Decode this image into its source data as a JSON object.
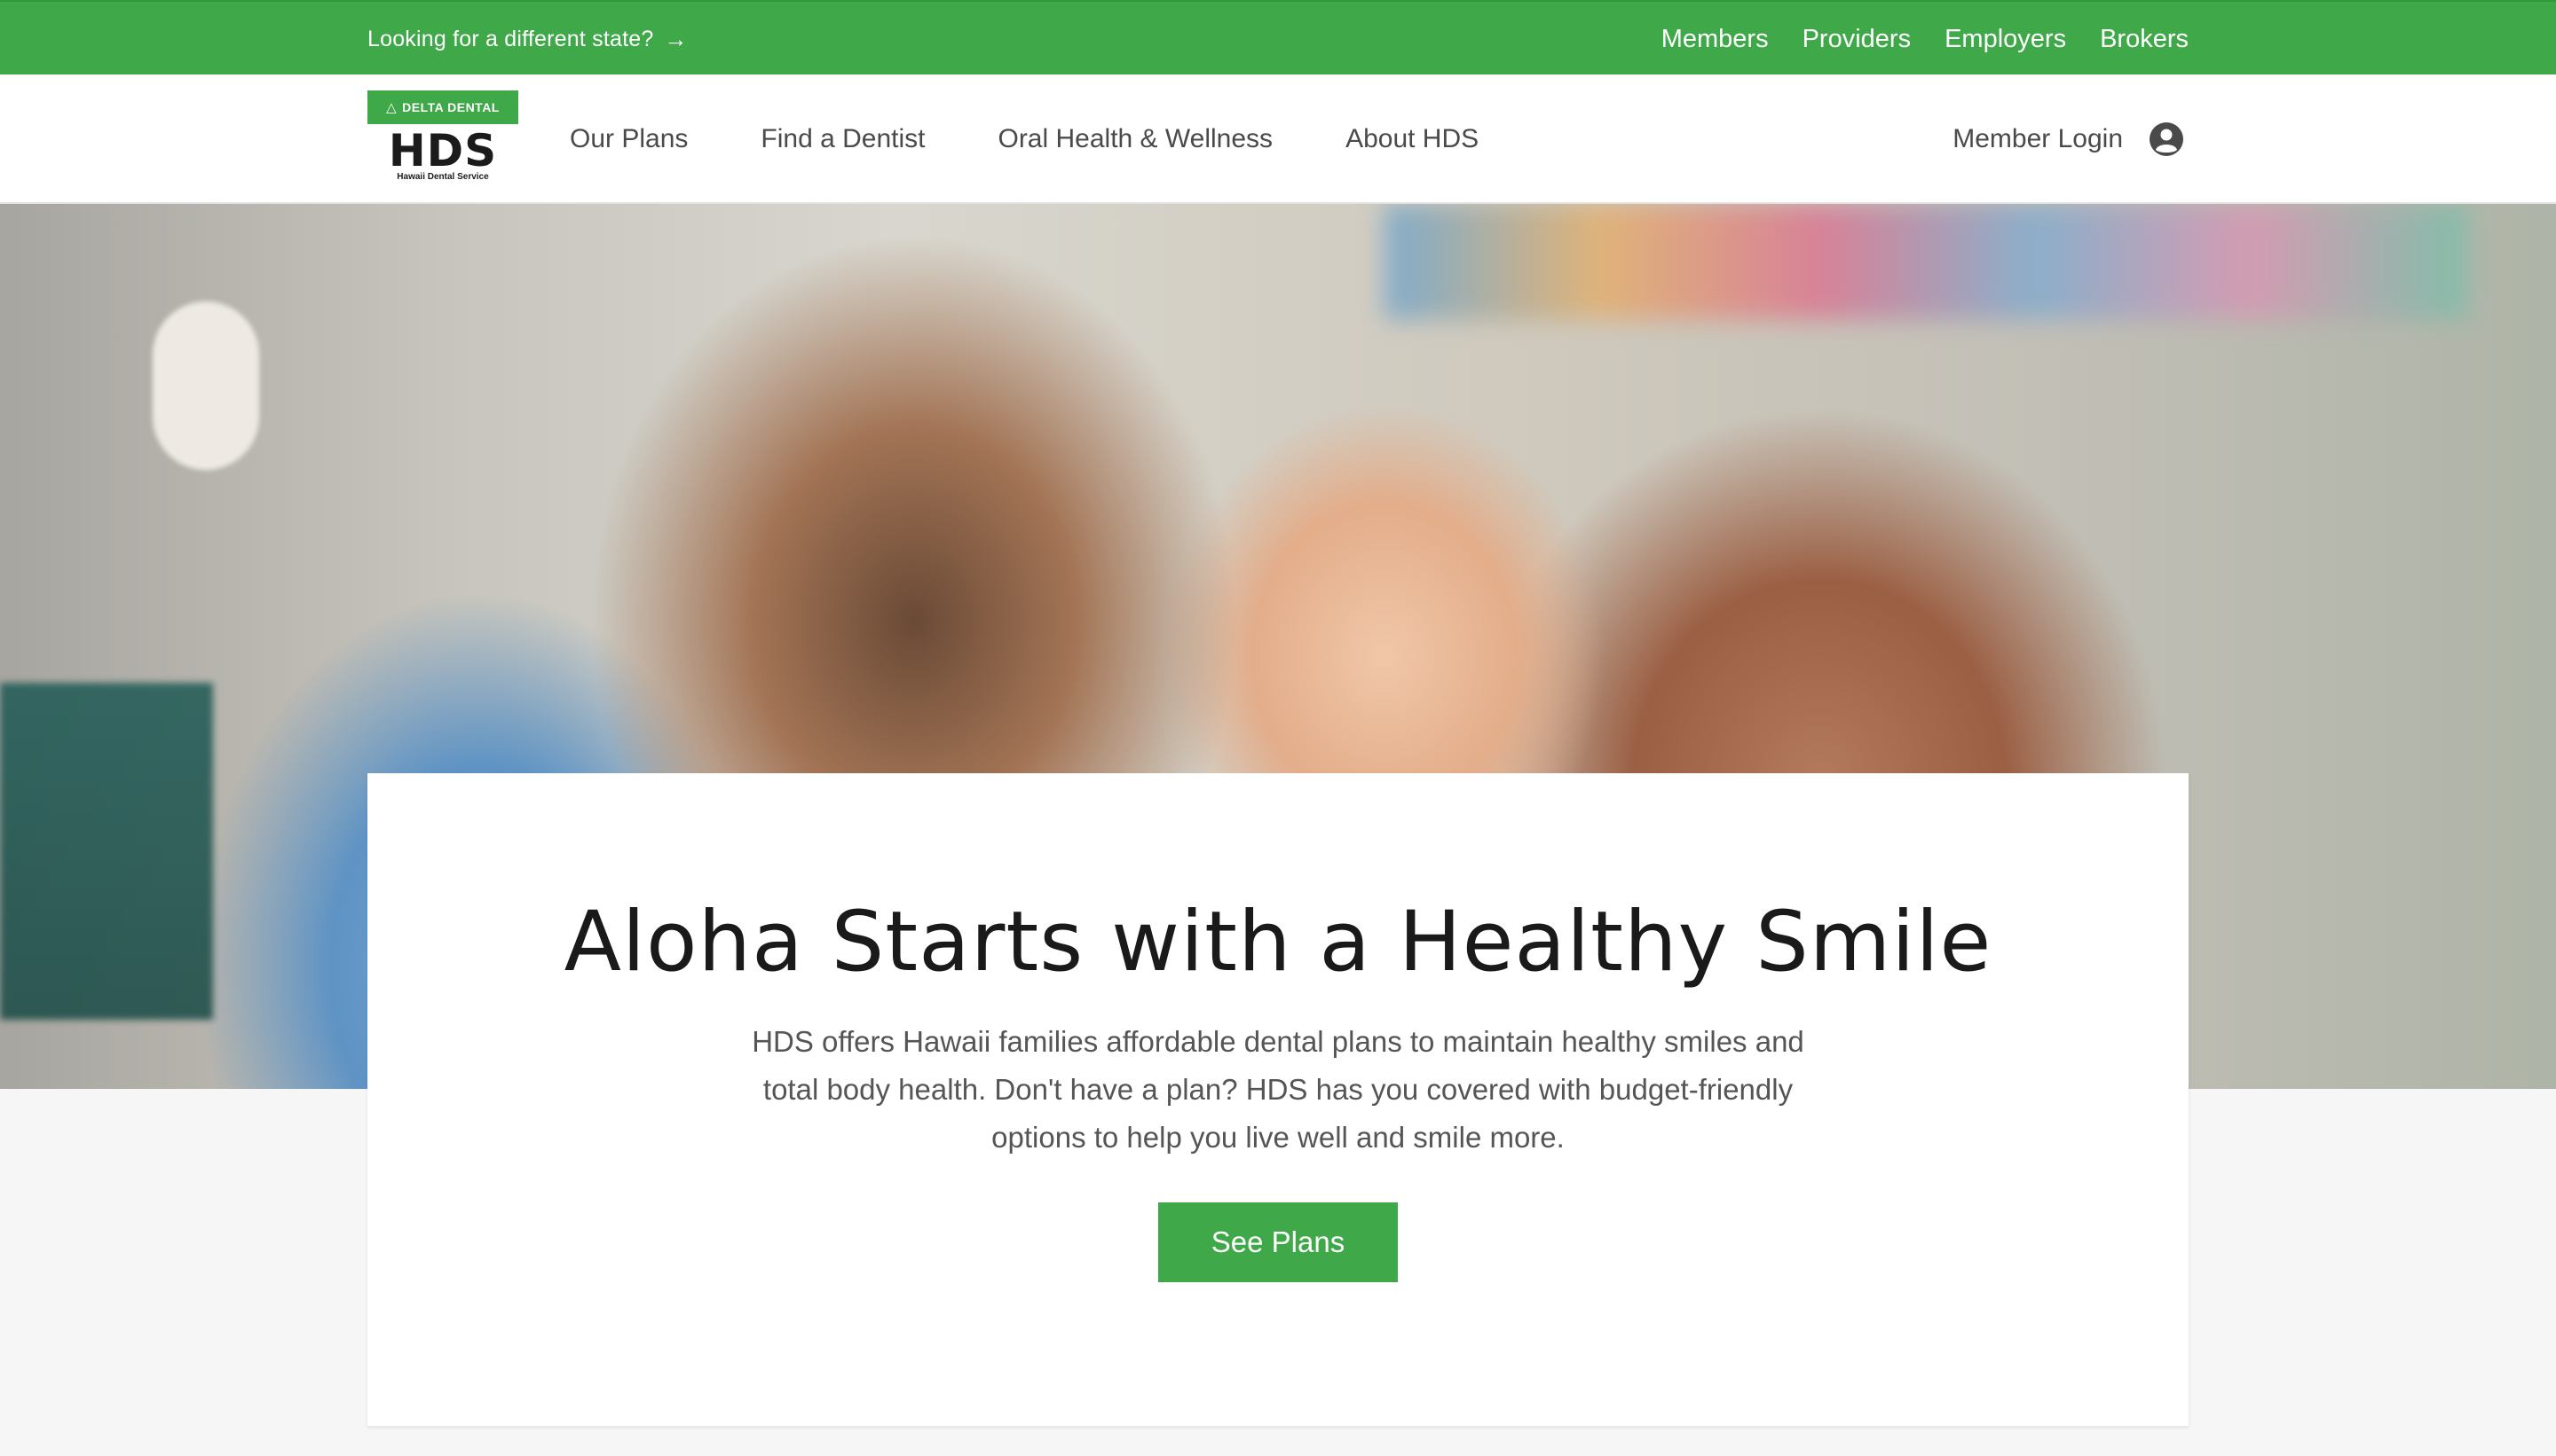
{
  "utility_bar": {
    "state_link": "Looking for a different state?",
    "audience_links": [
      "Members",
      "Providers",
      "Employers",
      "Brokers"
    ]
  },
  "header": {
    "logo": {
      "badge": "DELTA DENTAL",
      "wordmark": "HDS",
      "tagline": "Hawaii Dental Service"
    },
    "nav": [
      "Our Plans",
      "Find a Dentist",
      "Oral Health & Wellness",
      "About HDS"
    ],
    "login_label": "Member Login"
  },
  "hero": {
    "title": "Aloha Starts with a Healthy Smile",
    "body": "HDS offers Hawaii families affordable dental plans to maintain healthy smiles and total body health. Don't have a plan? HDS has you covered with budget-friendly options to help you live well and smile more.",
    "cta_label": "See Plans"
  },
  "icons": {
    "state_link": "arrow-right-icon",
    "login": "user-circle-icon",
    "logo_badge": "delta-icon"
  },
  "colors": {
    "brand_green": "#3fa94a",
    "nav_text": "#4a4a4a",
    "title_text": "#1a1a1a",
    "body_text": "#555555"
  }
}
